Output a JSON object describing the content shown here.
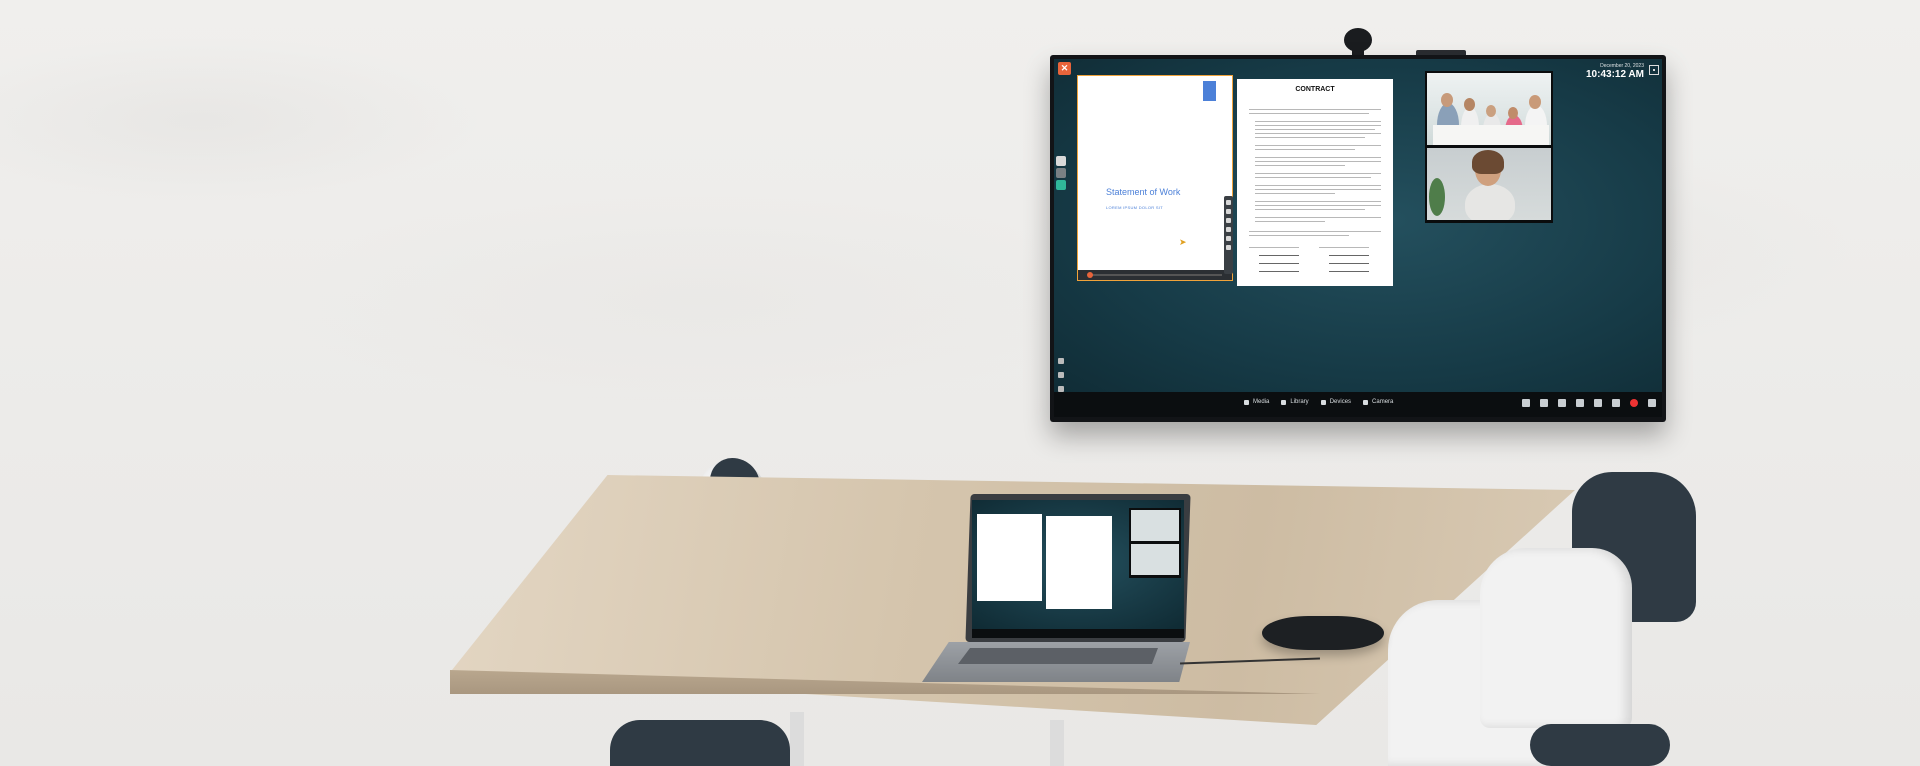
{
  "tv": {
    "date": "December 20, 2023",
    "time": "10:43:12 AM"
  },
  "doc_left": {
    "title": "Statement of Work",
    "subtitle": "LOREM IPSUM DOLOR SIT"
  },
  "doc_right": {
    "title": "CONTRACT"
  },
  "taskbar": {
    "items": [
      "Media",
      "Library",
      "Devices",
      "Camera"
    ]
  },
  "icons": {
    "app_logo": "app-logo-icon",
    "grid": "grid-layout-icon",
    "cursor": "pointer-cursor-icon"
  },
  "colors": {
    "accent": "#e8643b",
    "doc_blue": "#4c80d8",
    "screen_bg": "#163a46",
    "teal_button": "#30b89a"
  }
}
